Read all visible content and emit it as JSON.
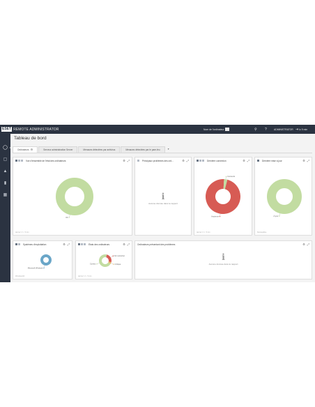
{
  "topbar": {
    "logo_box": "ESET",
    "logo_text": "REMOTE ADMINISTRATOR",
    "computer_name_label": "Nom de l'ordinateur",
    "user": "ADMINISTRATOR",
    "logout": "Ic 9 min"
  },
  "sidebar": {
    "items": [
      {
        "icon": "dashboard-icon"
      },
      {
        "icon": "computers-icon"
      },
      {
        "icon": "threats-icon"
      },
      {
        "icon": "reports-icon"
      },
      {
        "icon": "admin-icon"
      }
    ]
  },
  "page": {
    "title": "Tableau de bord"
  },
  "tabs": [
    {
      "label": "Ordinateurs",
      "active": true
    },
    {
      "label": "Serveur administration Server"
    },
    {
      "label": "Menaces détectées par antivirus"
    },
    {
      "label": "Menaces détectées par le pare-feu"
    }
  ],
  "widgets": {
    "w1": {
      "title": "Vue d'ensemble de l'état des ordinateurs",
      "footer": "dernier 1 h · 5 min",
      "slices": [
        {
          "label": "OK",
          "value": 100,
          "color": "#c2dca1"
        }
      ]
    },
    "w2": {
      "title": "Principaux problèmes des ord...",
      "nodata_icon": "i",
      "nodata_text": "Aucune donnée dans le rapport"
    },
    "w3": {
      "title": "Dernière connexion",
      "footer": "dernier 1 h · 5 min",
      "slices": [
        {
          "label": "Ancienne",
          "value": 97,
          "color": "#d75b54"
        },
        {
          "label": "Connecté",
          "value": 3,
          "color": "#c2dca1"
        }
      ]
    },
    "w4": {
      "title": "Dernière mise à jour",
      "footer": "Remaquillée",
      "slices": [
        {
          "label": "À jour",
          "value": 100,
          "color": "#c2dca1"
        }
      ]
    },
    "w5": {
      "title": "Systèmes d'exploitation",
      "footer": "Windows/AV",
      "slices": [
        {
          "label": "Microsoft Windows",
          "value": 100,
          "color": "#6aa6c8"
        }
      ]
    },
    "w6": {
      "title": "États des ordinateurs",
      "footer": "dernier 1 h · 5 min",
      "slices": [
        {
          "label": "Non sécurisé",
          "value": 25,
          "color": "#d75b54"
        },
        {
          "label": "Critique",
          "value": 5,
          "color": "#e8b96a"
        },
        {
          "label": "Correct",
          "value": 70,
          "color": "#c2dca1"
        }
      ]
    },
    "w7": {
      "title": "Ordinateurs présentant des problèmes",
      "nodata_icon": "i",
      "nodata_text": "Aucune donnée dans le rapport"
    }
  }
}
